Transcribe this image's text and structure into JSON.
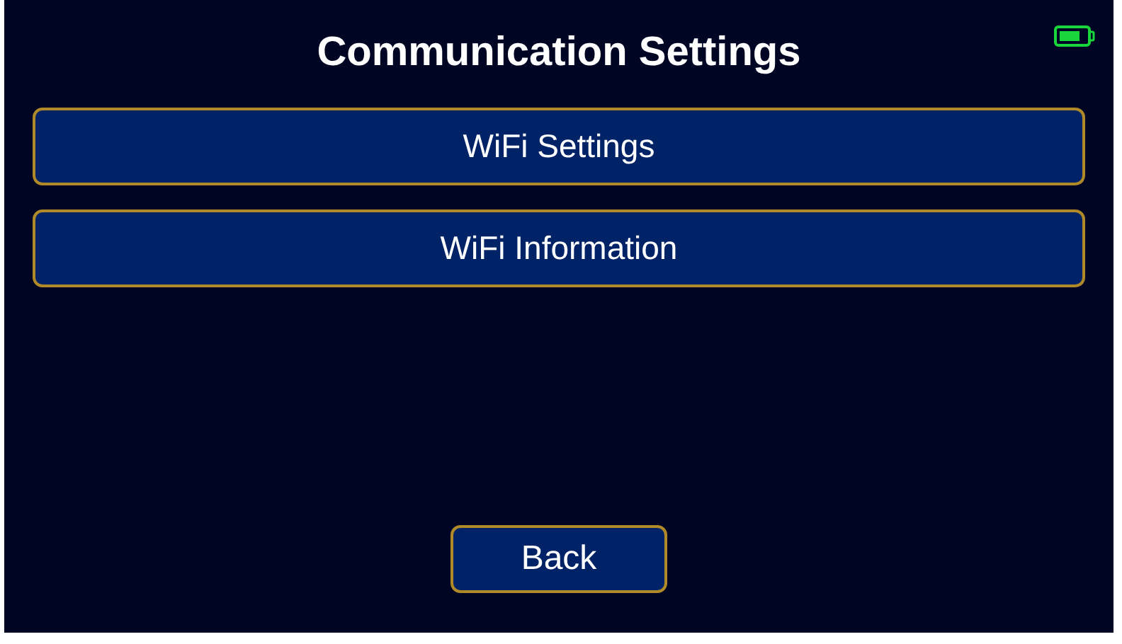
{
  "title": "Communication Settings",
  "menu": [
    {
      "label": "WiFi Settings"
    },
    {
      "label": "WiFi Information"
    }
  ],
  "back_button": "Back"
}
